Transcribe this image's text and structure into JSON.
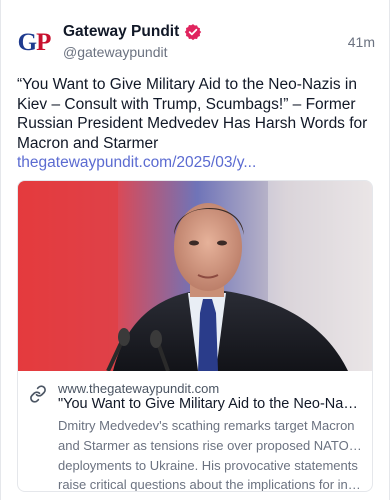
{
  "post": {
    "author": {
      "display_name": "Gateway Pundit",
      "handle": "@gatewaypundit",
      "avatar_text_g": "G",
      "avatar_text_p": "P",
      "verified_icon": "verified-badge-icon",
      "verified_color": "#e0245e"
    },
    "timestamp": "41m",
    "text": "“You Want to Give Military Aid to the Neo-Nazis in Kiev – Consult with Trump, Scumbags!” – Former Russian President Medvedev Has Harsh Words for Macron and Starmer",
    "link": "thegatewaypundit.com/2025/03/y...",
    "link_color": "#5b6bd1"
  },
  "card": {
    "image_description_icon": "photo",
    "link_icon": "link-icon",
    "domain": "www.thegatewaypundit.com",
    "title": "\"You Want to Give Military Aid to the Neo-Nazi...",
    "description_lines": [
      "Dmitry Medvedev's scathing remarks target Macron",
      "and Starmer as tensions rise over proposed NATO troop",
      "deployments to Ukraine. His provocative statements",
      "raise critical questions about the implications for inter..."
    ]
  }
}
